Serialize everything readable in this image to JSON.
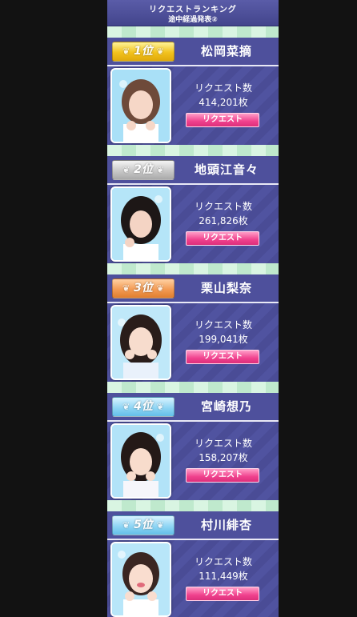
{
  "header": {
    "line1": "リクエストランキング",
    "line2": "途中経過発表②"
  },
  "entries": [
    {
      "rank_label": "1位",
      "name": "松岡菜摘",
      "request_label": "リクエスト数",
      "count": "414,201枚",
      "button_label": "リクエスト",
      "medal": "gold"
    },
    {
      "rank_label": "2位",
      "name": "地頭江音々",
      "request_label": "リクエスト数",
      "count": "261,826枚",
      "button_label": "リクエスト",
      "medal": "silver"
    },
    {
      "rank_label": "3位",
      "name": "栗山梨奈",
      "request_label": "リクエスト数",
      "count": "199,041枚",
      "button_label": "リクエスト",
      "medal": "bronze"
    },
    {
      "rank_label": "4位",
      "name": "宮崎想乃",
      "request_label": "リクエスト数",
      "count": "158,207枚",
      "button_label": "リクエスト",
      "medal": "blue"
    },
    {
      "rank_label": "5位",
      "name": "村川緋杏",
      "request_label": "リクエスト数",
      "count": "111,449枚",
      "button_label": "リクエスト",
      "medal": "blue"
    }
  ]
}
